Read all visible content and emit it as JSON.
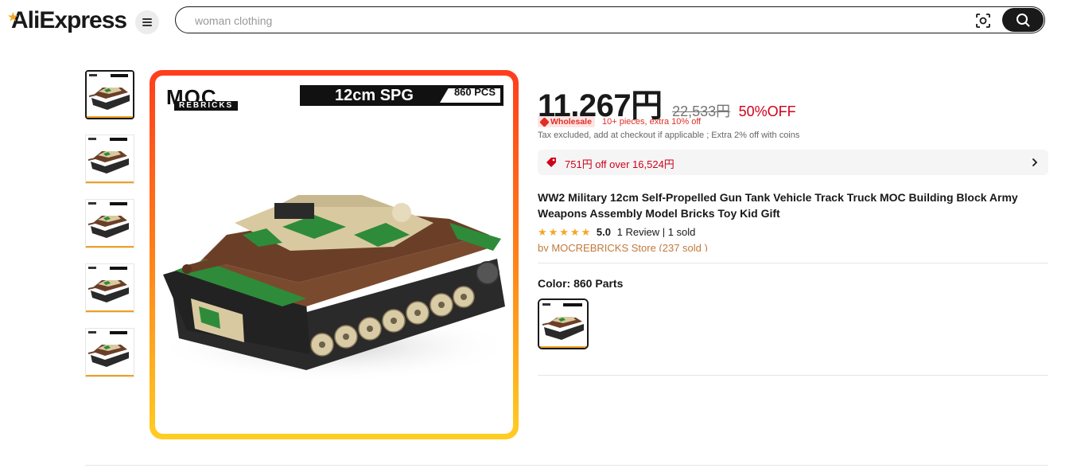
{
  "header": {
    "logo_text": "AliExpress",
    "search_placeholder": "woman clothing"
  },
  "gallery": {
    "thumbnail_count": 5,
    "main_image": {
      "brand_line1": "MOC",
      "brand_line2": "REBRICKS",
      "banner_title": "12cm SPG",
      "banner_pieces": "860 PCS"
    }
  },
  "product": {
    "price": "11,267円",
    "original_price": "22,533円",
    "discount": "50%OFF",
    "wholesale_badge": "Wholesale",
    "wholesale_text": "10+ pieces, extra 10% off",
    "tax_note": "Tax excluded, add at checkout if applicable ; Extra 2% off with coins",
    "coupon_text": "751円 off over 16,524円",
    "title": "WW2 Military 12cm Self-Propelled Gun Tank Vehicle Track Truck MOC Building Block Army Weapons Assembly Model Bricks Toy Kid Gift",
    "rating_value": "5.0",
    "review_text": "1 Review",
    "sold_text": "1 sold",
    "store_text": "by MOCREBRICKS Store (237 sold )",
    "color_label": "Color: 860 Parts"
  },
  "colors": {
    "accent_red": "#d0021b",
    "star": "#f5a623",
    "frame_top": "#ff3d1d",
    "frame_bottom": "#ffcd22"
  }
}
